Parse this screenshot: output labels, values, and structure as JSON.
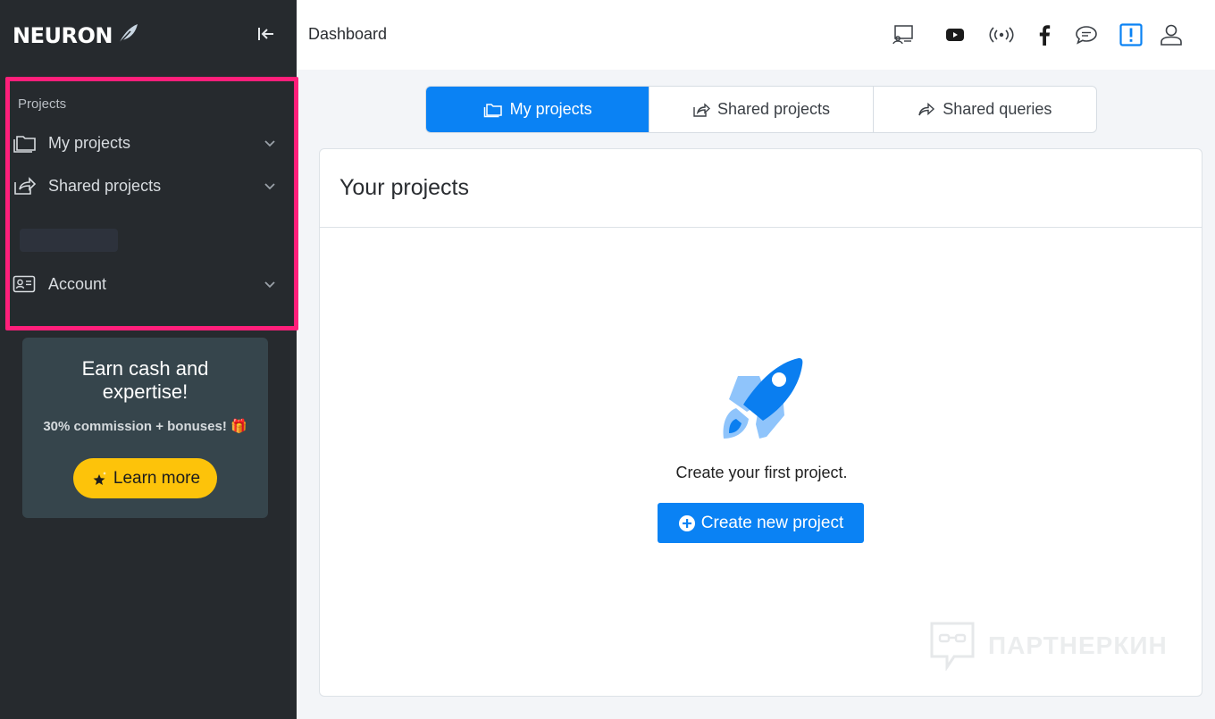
{
  "brand": {
    "name": "NEURON"
  },
  "header": {
    "title": "Dashboard"
  },
  "sidebar": {
    "section_label": "Projects",
    "items": [
      {
        "label": "My projects",
        "icon": "folders-icon"
      },
      {
        "label": "Shared projects",
        "icon": "share-icon"
      },
      {
        "label": "Account",
        "icon": "id-card-icon"
      }
    ],
    "highlight_color": "#ff1f7a"
  },
  "promo": {
    "title": "Earn cash and expertise!",
    "subtitle": "30% commission + bonuses! 🎁",
    "button_label": "Learn more",
    "button_color": "#fdc30a"
  },
  "tabs": [
    {
      "label": "My projects",
      "active": true
    },
    {
      "label": "Shared projects",
      "active": false
    },
    {
      "label": "Shared queries",
      "active": false
    }
  ],
  "card": {
    "title": "Your projects",
    "empty_text": "Create your first project.",
    "create_button_label": "Create new project"
  },
  "watermark": {
    "text": "ПАРТНЕРКИН"
  },
  "colors": {
    "accent": "#0a82f4",
    "sidebar_bg": "#262a2e"
  }
}
